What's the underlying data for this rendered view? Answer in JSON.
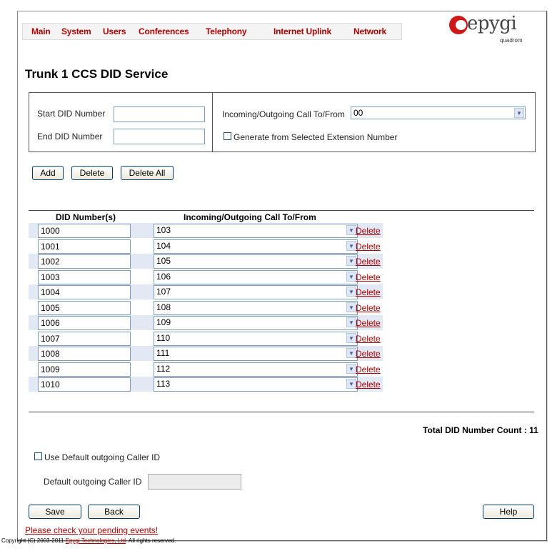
{
  "menu": [
    "Main",
    "System",
    "Users",
    "Conferences",
    "Telephony",
    "Internet Uplink",
    "Network"
  ],
  "logo": {
    "word": "epygi",
    "sub": "quadrom"
  },
  "page_title": "Trunk 1 CCS DID Service",
  "form": {
    "start_label": "Start DID Number",
    "end_label": "End DID Number",
    "start_value": "",
    "end_value": "",
    "call_label": "Incoming/Outgoing Call To/From",
    "call_value": "00",
    "generate_label": "Generate from Selected Extension Number"
  },
  "actions": {
    "add": "Add",
    "delete": "Delete",
    "delete_all": "Delete All"
  },
  "table": {
    "col_did": "DID Number(s)",
    "col_call": "Incoming/Outgoing Call To/From",
    "delete_label": "Delete",
    "rows": [
      {
        "did": "1000",
        "ext": "103"
      },
      {
        "did": "1001",
        "ext": "104"
      },
      {
        "did": "1002",
        "ext": "105"
      },
      {
        "did": "1003",
        "ext": "106"
      },
      {
        "did": "1004",
        "ext": "107"
      },
      {
        "did": "1005",
        "ext": "108"
      },
      {
        "did": "1006",
        "ext": "109"
      },
      {
        "did": "1007",
        "ext": "110"
      },
      {
        "did": "1008",
        "ext": "111"
      },
      {
        "did": "1009",
        "ext": "112"
      },
      {
        "did": "1010",
        "ext": "113"
      }
    ]
  },
  "total_label": "Total DID Number Count : 11",
  "default_caller": {
    "checkbox_label": "Use Default outgoing Caller ID",
    "field_label": "Default outgoing Caller ID",
    "field_value": ""
  },
  "buttons": {
    "save": "Save",
    "back": "Back",
    "help": "Help"
  },
  "pending_link": "Please check your pending events!",
  "footer": {
    "prefix": "Copyright (C) 2003-2011 ",
    "company": "Epygi Technologies, Ltd",
    "suffix": ". All rights reserved."
  }
}
